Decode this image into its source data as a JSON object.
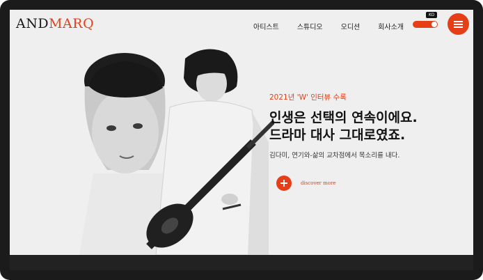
{
  "header": {
    "logo_part1": "AND",
    "logo_part2": "MARQ",
    "nav": [
      "아티스트",
      "스튜디오",
      "오디션",
      "회사소개"
    ],
    "lang_badge": "KO"
  },
  "hero": {
    "eyebrow": "2021년 'W' 인터뷰 수록",
    "headline_line1": "인생은 선택의 연속이에요.",
    "headline_line2": "드라마 대사 그대로였죠.",
    "subline": "김다미, 연기와-삶의 교차점에서 목소리를 내다.",
    "cta_label": "discover more"
  },
  "colors": {
    "accent": "#e63e17",
    "background": "#efefef",
    "frame": "#1b1b1b"
  }
}
